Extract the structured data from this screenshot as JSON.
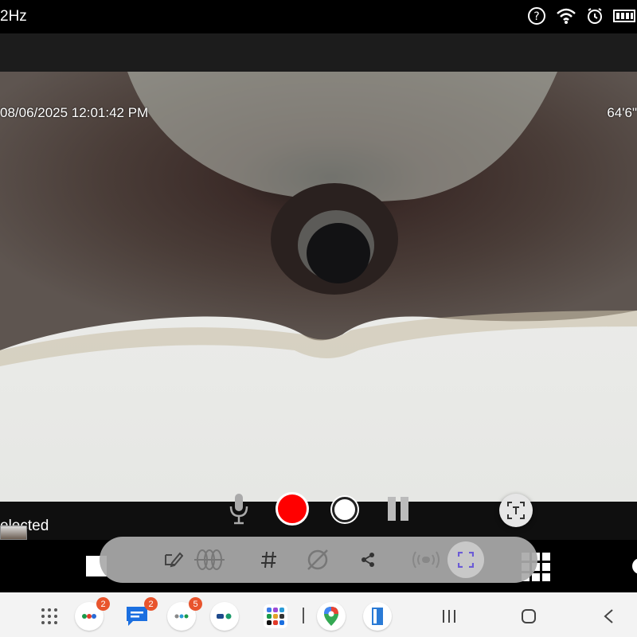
{
  "status_bar": {
    "left_text": "2Hz",
    "icons": [
      "help-circle-icon",
      "wifi-icon",
      "alarm-icon",
      "battery-icon"
    ]
  },
  "camera": {
    "timestamp": "08/06/2025  12:01:42 PM",
    "distance": "64'6\""
  },
  "controls": {
    "selected_label": "elected",
    "buttons": [
      "microphone-icon",
      "record-button",
      "snapshot-button",
      "pause-button",
      "text-scan-button"
    ]
  },
  "floating_toolbar": {
    "tools": [
      "edit-sign-icon",
      "wave-icon",
      "hash-icon",
      "slash-circle-icon",
      "share-icon",
      "signal-icon",
      "scan-frame-icon"
    ]
  },
  "taskbar": {
    "badges": {
      "app1": "2",
      "app2": "2",
      "app3": "5"
    },
    "nav": [
      "recents-icon",
      "home-icon",
      "back-icon"
    ]
  },
  "colors": {
    "record": "#ff0000",
    "badge": "#e8542d",
    "toolbar": "#aaaaaa"
  }
}
